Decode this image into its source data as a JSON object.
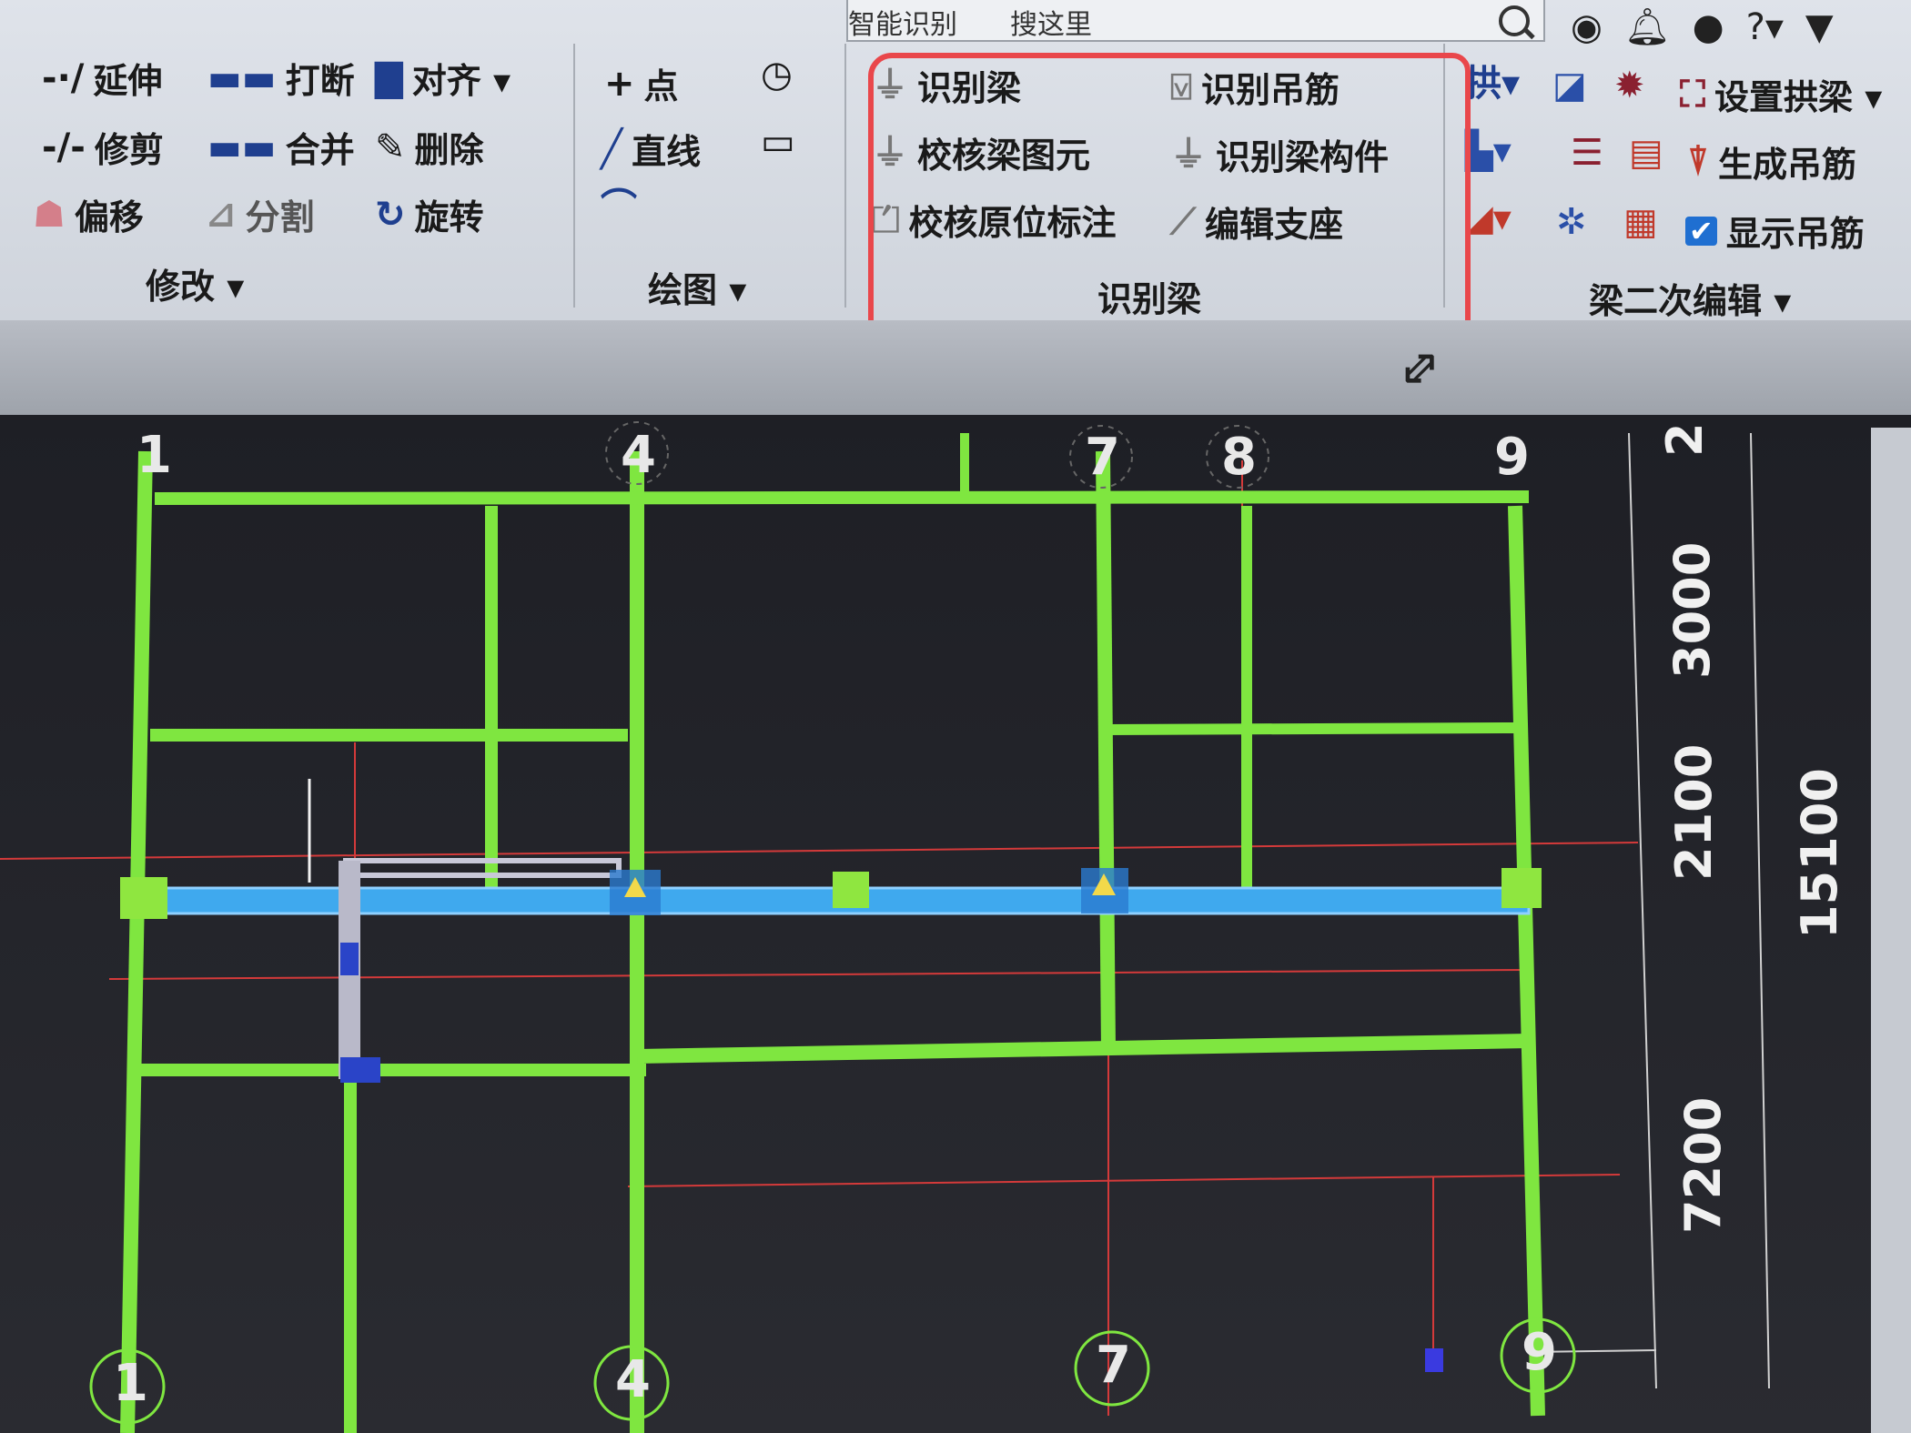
{
  "search": {
    "left_text": "智能识别",
    "right_text": "搜这里"
  },
  "modify": {
    "label": "修改 ▾",
    "tools": [
      "延伸",
      "打断",
      "对齐 ▾",
      "修剪",
      "合并",
      "删除",
      "偏移",
      "分割",
      "旋转"
    ]
  },
  "draw": {
    "label": "绘图 ▾",
    "tools": [
      "点",
      "直线"
    ]
  },
  "beam": {
    "label": "识别梁",
    "tools": [
      "识别梁",
      "识别吊筋",
      "校核梁图元",
      "识别梁构件",
      "校核原位标注",
      "编辑支座"
    ]
  },
  "secondary": {
    "label": "梁二次编辑 ▾",
    "tools": [
      "设置拱梁 ▾",
      "生成吊筋",
      "显示吊筋"
    ]
  },
  "icons": [
    "user-icon",
    "bell-icon",
    "chat-icon",
    "help-icon",
    "shirt-icon"
  ],
  "colors": {
    "grid": "#7fe640",
    "beam": "#3fa9ee",
    "accent": "#e9474b"
  },
  "axes": {
    "top": [
      "1",
      "4",
      "7",
      "8",
      "9"
    ],
    "bottom": [
      "1",
      "4",
      "7",
      "9"
    ],
    "right_top": "2"
  },
  "dimensions": [
    "3000",
    "2100",
    "7200",
    "15100"
  ]
}
